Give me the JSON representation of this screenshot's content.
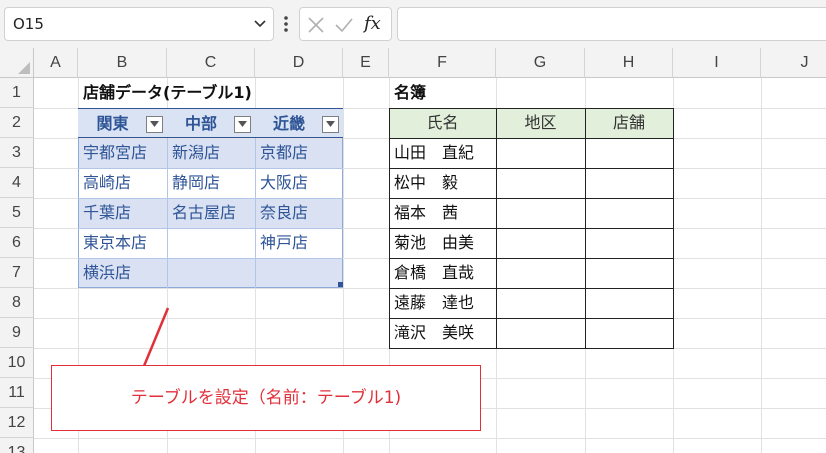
{
  "formula_bar": {
    "name_box": "O15",
    "fx_label": "fx",
    "formula": ""
  },
  "columns": [
    "A",
    "B",
    "C",
    "D",
    "E",
    "F",
    "G",
    "H",
    "I",
    "J"
  ],
  "rows": [
    "1",
    "2",
    "3",
    "4",
    "5",
    "6",
    "7",
    "8",
    "9",
    "10",
    "11",
    "12",
    "13"
  ],
  "store_table": {
    "title": "店舗データ(テーブル1)",
    "headers": [
      "関東",
      "中部",
      "近畿"
    ],
    "rows": [
      [
        "宇都宮店",
        "新潟店",
        "京都店"
      ],
      [
        "高崎店",
        "静岡店",
        "大阪店"
      ],
      [
        "千葉店",
        "名古屋店",
        "奈良店"
      ],
      [
        "東京本店",
        "",
        "神戸店"
      ],
      [
        "横浜店",
        "",
        ""
      ]
    ]
  },
  "roster": {
    "title": "名簿",
    "headers": [
      "氏名",
      "地区",
      "店舗"
    ],
    "names": [
      "山田　直紀",
      "松中　毅",
      "福本　茜",
      "菊池　由美",
      "倉橋　直哉",
      "遠藤　達也",
      "滝沢　美咲"
    ]
  },
  "callout": {
    "text": "テーブルを設定（名前：テーブル1)"
  },
  "colors": {
    "table_header_text": "#2f5597",
    "table_band": "#d9e1f2",
    "roster_header": "#e2efda",
    "callout": "#e0303a"
  }
}
